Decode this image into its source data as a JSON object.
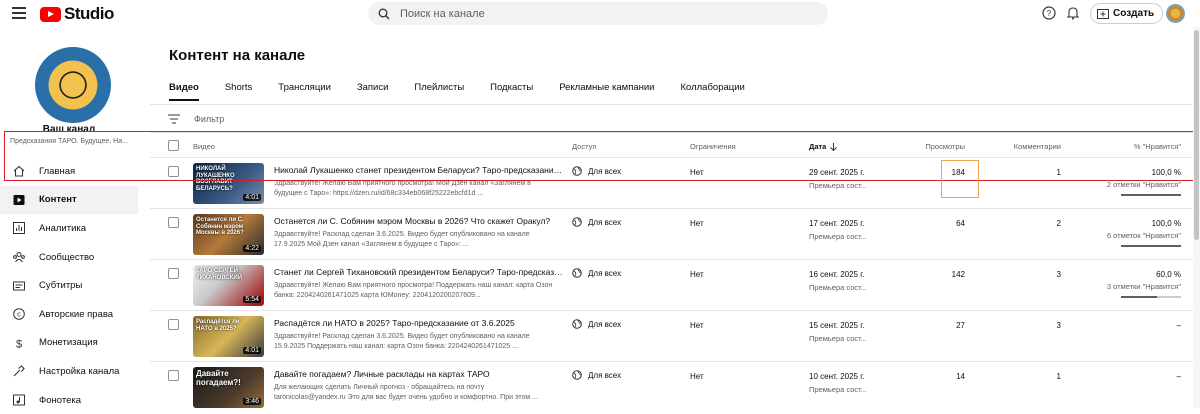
{
  "header": {
    "logo_text": "Studio",
    "search_placeholder": "Поиск на канале",
    "create_label": "Создать"
  },
  "channel": {
    "name": "Ваш канал",
    "subtitle": "Предсказания ТАРО. Будущее, На..."
  },
  "nav": {
    "items": [
      {
        "label": "Главная",
        "icon": "home-icon"
      },
      {
        "label": "Контент",
        "icon": "content-icon",
        "active": true
      },
      {
        "label": "Аналитика",
        "icon": "analytics-icon"
      },
      {
        "label": "Сообщество",
        "icon": "community-icon"
      },
      {
        "label": "Субтитры",
        "icon": "subtitles-icon"
      },
      {
        "label": "Авторские права",
        "icon": "copyright-icon"
      },
      {
        "label": "Монетизация",
        "icon": "monetization-icon"
      },
      {
        "label": "Настройка канала",
        "icon": "customization-icon"
      },
      {
        "label": "Фонотека",
        "icon": "audio-library-icon"
      }
    ]
  },
  "page": {
    "title": "Контент на канале",
    "tabs": [
      "Видео",
      "Shorts",
      "Трансляции",
      "Записи",
      "Плейлисты",
      "Подкасты",
      "Рекламные кампании",
      "Коллаборации"
    ],
    "active_tab": "Видео",
    "filter_label": "Фильтр"
  },
  "table": {
    "headers": {
      "video": "Видео",
      "visibility": "Доступ",
      "restrictions": "Ограничения",
      "date": "Дата",
      "views": "Просмотры",
      "comments": "Комментарии",
      "likes": "% \"Нравится\""
    },
    "rows": [
      {
        "title": "Николай Лукашенко станет президентом Беларуси? Таро-предсказание ...",
        "description": "Здравствуйте! Желаю Вам приятного просмотра! Мой Дзен канал «Заглянем в будущее с Таро»: https://dzen.ru/id/68c334eb068f25222ebcfd1d ...",
        "thumb_text": "НИКОЛАЙ ЛУКАШЕНКО ВОЗГЛАВИТ БЕЛАРУСЬ?",
        "duration": "4:01",
        "visibility": "Для всех",
        "restrictions": "Нет",
        "date": "29 сент. 2025 г.",
        "date_sub": "Премьера сост...",
        "views": "184",
        "comments": "1",
        "like_pct": "100,0 %",
        "like_count": "2 отметки \"Нравится\"",
        "like_ratio": 1.0
      },
      {
        "title": "Останется ли С. Собянин мэром Москвы в 2026? Что скажет Оракул?",
        "description": "Здравствуйте! Расклад сделан 3.6.2025. Видео будет опубликовано на канале 17.9.2025 Мой Дзен канал «Заглянем в будущее с Таро»: ...",
        "thumb_text": "Останется ли С. Собянин мэром Москвы в 2026?",
        "duration": "4:22",
        "visibility": "Для всех",
        "restrictions": "Нет",
        "date": "17 сент. 2025 г.",
        "date_sub": "Премьера сост...",
        "views": "64",
        "comments": "2",
        "like_pct": "100,0 %",
        "like_count": "6 отметок \"Нравится\"",
        "like_ratio": 1.0
      },
      {
        "title": "Станет ли Сергей Тихановский президентом Беларуси? Таро-предсказание ...",
        "description": "Здравствуйте! Желаю Вам приятного просмотра! Поддержать наш канал: карта Озон банка: 2204240261471025 карта ЮMoney: 2204120200207609...",
        "thumb_text": "ТАРО СЕРГЕЙ ТИХАНОВСКИЙ",
        "duration": "5:54",
        "visibility": "Для всех",
        "restrictions": "Нет",
        "date": "16 сент. 2025 г.",
        "date_sub": "Премьера сост...",
        "views": "142",
        "comments": "3",
        "like_pct": "60,0 %",
        "like_count": "3 отметки \"Нравится\"",
        "like_ratio": 0.6
      },
      {
        "title": "Распадётся ли НАТО в 2025? Таро-предсказание от 3.6.2025",
        "description": "Здравствуйте! Расклад сделан 3.6.2025. Видео будет опубликовано на канале 15.9.2025 Поддержать наш канал: карта Озон банка: 2204240261471025 ...",
        "thumb_text": "Распадётся ли НАТО в 2025?",
        "duration": "4:01",
        "visibility": "Для всех",
        "restrictions": "Нет",
        "date": "15 сент. 2025 г.",
        "date_sub": "Премьера сост...",
        "views": "27",
        "comments": "3",
        "like_pct": "–",
        "like_count": "",
        "like_ratio": null
      },
      {
        "title": "Давайте погадаем? Личные расклады на картах ТАРО",
        "description": "Для желающих сделать Личный прогноз - обращайтесь на почту taronicolas@yandex.ru Это для вас будет очень удобно и комфортно. При этом ...",
        "thumb_text": "Давайте погадаем?!",
        "duration": "3:46",
        "visibility": "Для всех",
        "restrictions": "Нет",
        "date": "10 сент. 2025 г.",
        "date_sub": "Премьера сост...",
        "views": "14",
        "comments": "1",
        "like_pct": "–",
        "like_count": "",
        "like_ratio": null
      }
    ]
  },
  "colors": {
    "brand_red": "#ff0000",
    "highlight_row": "#d21f26",
    "highlight_views": "#f4a24b"
  }
}
